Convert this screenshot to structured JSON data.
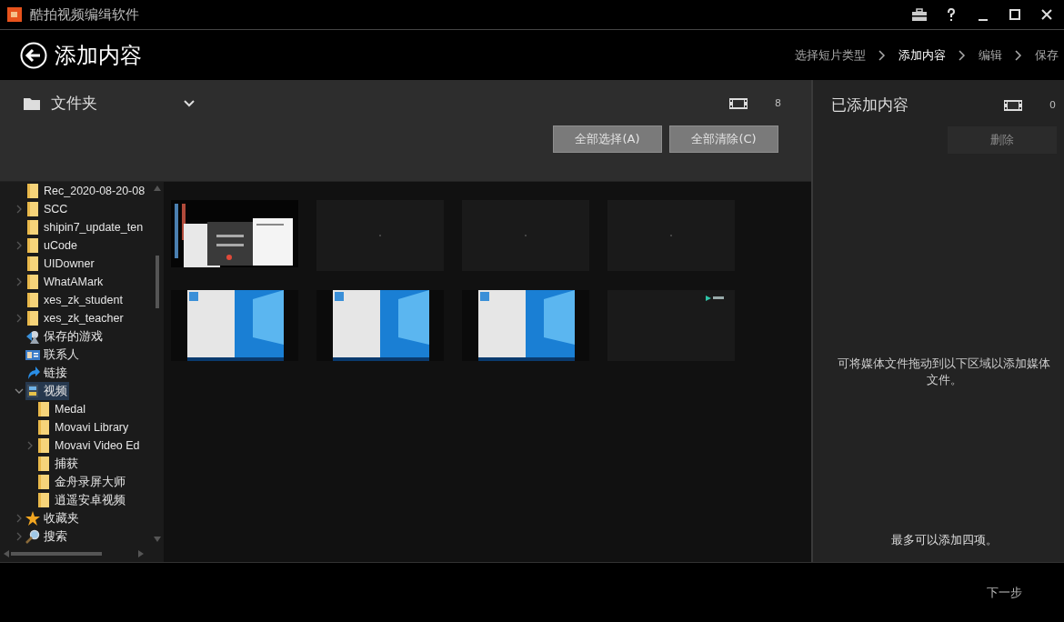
{
  "window": {
    "title": "酷拍视频编缉软件"
  },
  "header": {
    "title": "添加内容"
  },
  "steps": [
    {
      "label": "选择短片类型",
      "selected": false
    },
    {
      "label": "添加内容",
      "selected": true
    },
    {
      "label": "编辑",
      "selected": false
    },
    {
      "label": "保存",
      "selected": false
    }
  ],
  "library": {
    "source": "文件夹",
    "count": "8",
    "buttons": [
      "全部选择(A)",
      "全部清除(C)"
    ]
  },
  "tree": [
    {
      "label": "Rec_2020-08-20-08",
      "kind": "folder",
      "selected": false
    },
    {
      "label": "SCC",
      "kind": "folder",
      "expanded": false,
      "selected": false
    },
    {
      "label": "shipin7_update_ten",
      "kind": "folder",
      "selected": false
    },
    {
      "label": "uCode",
      "kind": "folder",
      "expanded": false,
      "selected": false
    },
    {
      "label": "UIDowner",
      "kind": "folder",
      "selected": false
    },
    {
      "label": "WhatAMark",
      "kind": "folder",
      "expanded": false,
      "selected": false
    },
    {
      "label": "xes_zk_student",
      "kind": "folder",
      "selected": false
    },
    {
      "label": "xes_zk_teacher",
      "kind": "folder",
      "expanded": false,
      "selected": false
    },
    {
      "label": "保存的游戏",
      "kind": "games",
      "selected": false
    },
    {
      "label": "联系人",
      "kind": "contacts",
      "selected": false
    },
    {
      "label": "链接",
      "kind": "link",
      "selected": false
    },
    {
      "label": "视频",
      "kind": "videos",
      "expanded": true,
      "selected": true,
      "children": [
        {
          "label": "Medal",
          "kind": "folder",
          "selected": false
        },
        {
          "label": "Movavi Library",
          "kind": "folder",
          "selected": false
        },
        {
          "label": "Movavi Video Ed",
          "kind": "folder",
          "expanded": false,
          "selected": false
        },
        {
          "label": "捕获",
          "kind": "folder",
          "selected": false
        },
        {
          "label": "金舟录屏大师",
          "kind": "folder",
          "selected": false
        },
        {
          "label": "逍遥安卓视频",
          "kind": "folder",
          "selected": false
        }
      ]
    },
    {
      "label": "收藏夹",
      "kind": "favorites",
      "expanded": false,
      "selected": false
    },
    {
      "label": "搜索",
      "kind": "search",
      "expanded": false,
      "selected": false
    }
  ],
  "thumbnails": [
    {
      "kind": "desktop"
    },
    {
      "kind": "blank"
    },
    {
      "kind": "blank"
    },
    {
      "kind": "blank"
    },
    {
      "kind": "window"
    },
    {
      "kind": "window"
    },
    {
      "kind": "window"
    },
    {
      "kind": "logo"
    }
  ],
  "added": {
    "title": "已添加内容",
    "count": "0",
    "delete_button": "删除",
    "hint": "可将媒体文件拖动到以下区域以添加媒体文件。",
    "limit": "最多可以添加四项。"
  },
  "footer": {
    "next_button": "下一步"
  }
}
